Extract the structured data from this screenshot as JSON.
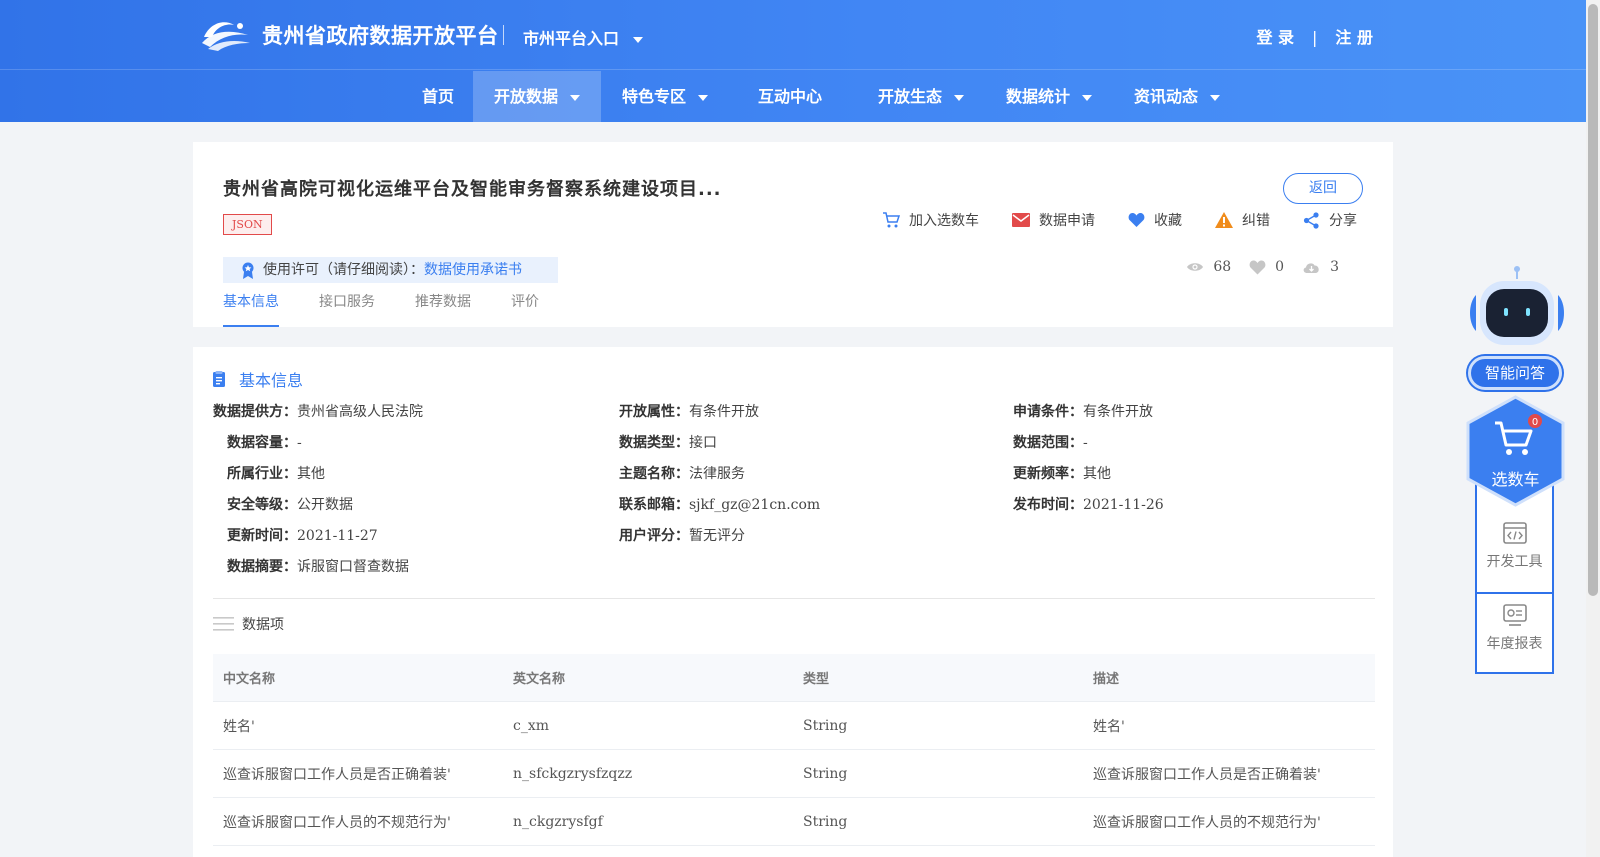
{
  "header": {
    "site_title": "贵州省政府数据开放平台",
    "city_entry": "市州平台入口",
    "login": "登 录",
    "separator": "|",
    "register": "注 册"
  },
  "nav": {
    "items": [
      {
        "label": "首页",
        "has_dropdown": false,
        "active": false
      },
      {
        "label": "开放数据",
        "has_dropdown": true,
        "active": true
      },
      {
        "label": "特色专区",
        "has_dropdown": true,
        "active": false
      },
      {
        "label": "互动中心",
        "has_dropdown": false,
        "active": false
      },
      {
        "label": "开放生态",
        "has_dropdown": true,
        "active": false
      },
      {
        "label": "数据统计",
        "has_dropdown": true,
        "active": false
      },
      {
        "label": "资讯动态",
        "has_dropdown": true,
        "active": false
      }
    ]
  },
  "dataset": {
    "title": "贵州省高院可视化运维平台及智能审务督察系统建设项目...",
    "format_tag": "JSON",
    "back_label": "返回",
    "actions": {
      "cart": "加入选数车",
      "apply": "数据申请",
      "favorite": "收藏",
      "report": "纠错",
      "share": "分享"
    },
    "license": {
      "prefix": "使用许可（请仔细阅读）：",
      "link": "数据使用承诺书"
    },
    "stats": {
      "views": "68",
      "likes": "0",
      "downloads": "3"
    },
    "tabs": [
      "基本信息",
      "接口服务",
      "推荐数据",
      "评价"
    ],
    "active_tab": "基本信息"
  },
  "basic_info": {
    "section_title": "基本信息",
    "fields": {
      "provider": {
        "label": "数据提供方：",
        "value": "贵州省高级人民法院"
      },
      "open_attr": {
        "label": "开放属性：",
        "value": "有条件开放"
      },
      "apply_cond": {
        "label": "申请条件：",
        "value": "有条件开放"
      },
      "capacity": {
        "label": "数据容量：",
        "value": "-"
      },
      "data_type": {
        "label": "数据类型：",
        "value": "接口"
      },
      "scope": {
        "label": "数据范围：",
        "value": "-"
      },
      "industry": {
        "label": "所属行业：",
        "value": "其他"
      },
      "topic": {
        "label": "主题名称：",
        "value": "法律服务"
      },
      "frequency": {
        "label": "更新频率：",
        "value": "其他"
      },
      "security": {
        "label": "安全等级：",
        "value": "公开数据"
      },
      "email": {
        "label": "联系邮箱：",
        "value": "sjkf_gz@21cn.com"
      },
      "publish_time": {
        "label": "发布时间：",
        "value": "2021-11-26"
      },
      "update_time": {
        "label": "更新时间：",
        "value": "2021-11-27"
      },
      "rating": {
        "label": "用户评分：",
        "value": "暂无评分"
      },
      "summary": {
        "label": "数据摘要：",
        "value": "诉服窗口督查数据"
      }
    }
  },
  "data_items": {
    "title": "数据项",
    "columns": [
      "中文名称",
      "英文名称",
      "类型",
      "描述"
    ],
    "rows": [
      [
        "姓名'",
        "c_xm",
        "String",
        "姓名'"
      ],
      [
        "巡查诉服窗口工作人员是否正确着装'",
        "n_sfckgzrysfzqzz",
        "String",
        "巡查诉服窗口工作人员是否正确着装'"
      ],
      [
        "巡查诉服窗口工作人员的不规范行为'",
        "n_ckgzrysfgf",
        "String",
        "巡查诉服窗口工作人员的不规范行为'"
      ]
    ]
  },
  "float_tools": {
    "ask": "智能问答",
    "cart": "选数车",
    "cart_count": "0",
    "dev_tools": "开发工具",
    "annual_report": "年度报表"
  },
  "colors": {
    "primary": "#3b7ff0",
    "header_gradient_start": "#3173e8",
    "header_gradient_end": "#4a93f7",
    "tag_red": "#e24a4a"
  }
}
